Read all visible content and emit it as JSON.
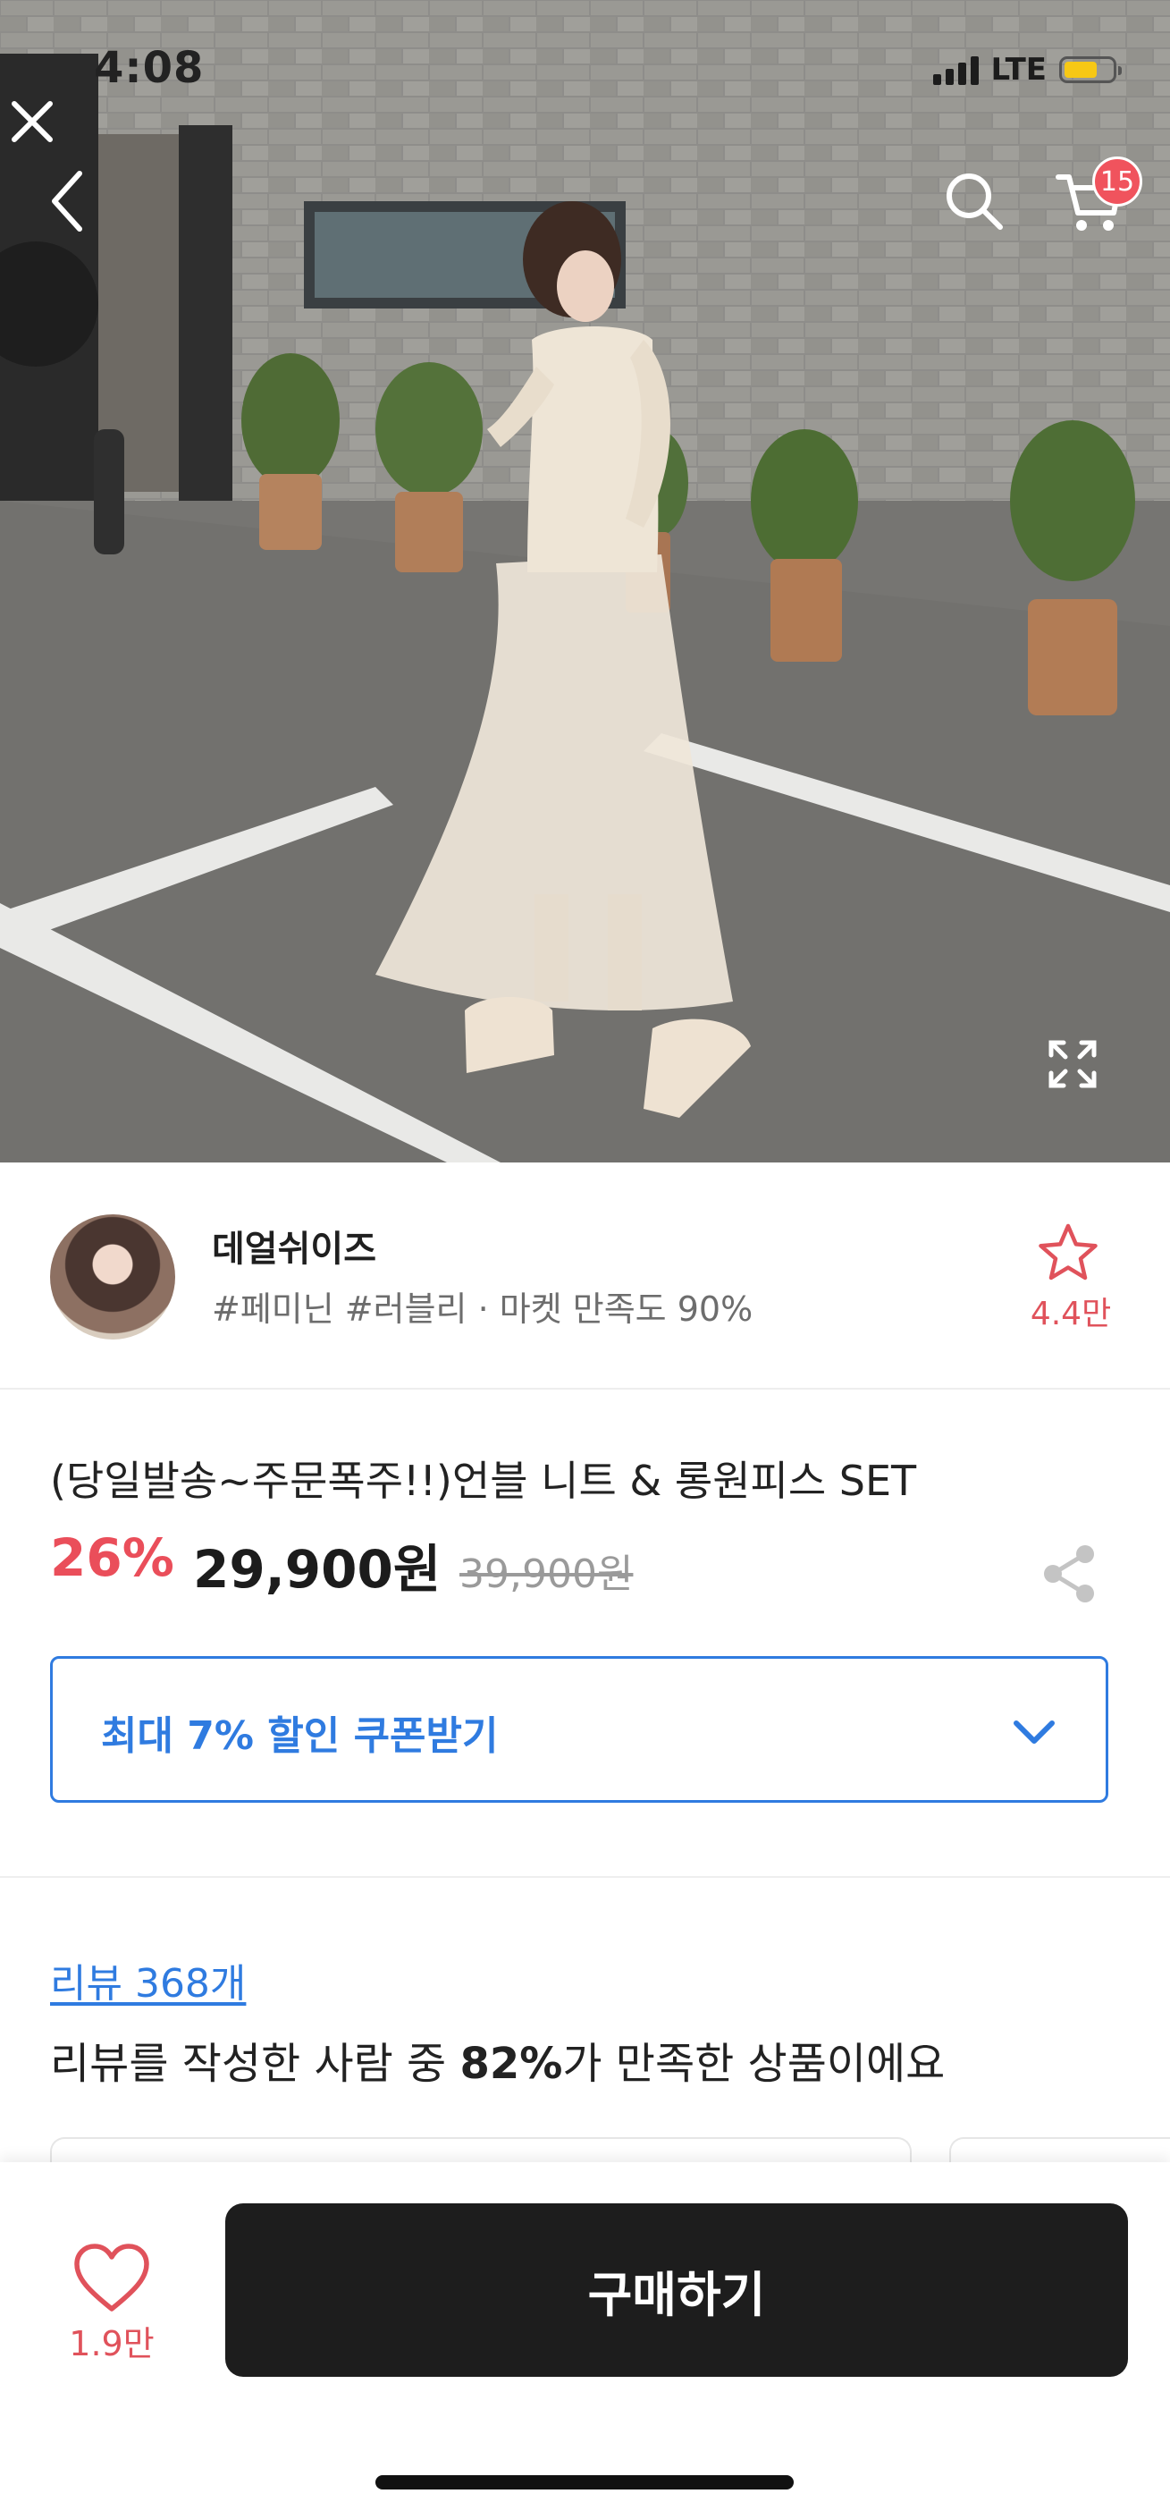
{
  "status_bar": {
    "time": "4:08",
    "network": "LTE"
  },
  "header": {
    "cart_count": "15"
  },
  "seller": {
    "name": "데얼쉬이즈",
    "tags": "#페미닌 #러블리 · 마켓 만족도 90%",
    "favorite_count": "4.4만"
  },
  "product": {
    "title": "(당일발송~주문폭주!!)언블 니트 & 롱원피스 SET",
    "discount": "26%",
    "price": "29,900원",
    "original_price": "39,900원",
    "coupon_label": "최대 7% 할인 쿠폰받기"
  },
  "review": {
    "link": "리뷰 368개",
    "summary_prefix": "리뷰를 작성한 사람 중 ",
    "summary_percent": "82%",
    "summary_suffix": "가 만족한 상품이에요"
  },
  "bottom_bar": {
    "like_count": "1.9만",
    "buy_label": "구매하기"
  },
  "colors": {
    "accent_red": "#ea4e5a",
    "accent_blue": "#2f7be0",
    "buy_button": "#1d1d1d"
  },
  "icons": [
    "close-icon",
    "back-icon",
    "search-icon",
    "cart-icon",
    "expand-icon",
    "star-icon",
    "share-icon",
    "chevron-down-icon",
    "heart-icon"
  ]
}
